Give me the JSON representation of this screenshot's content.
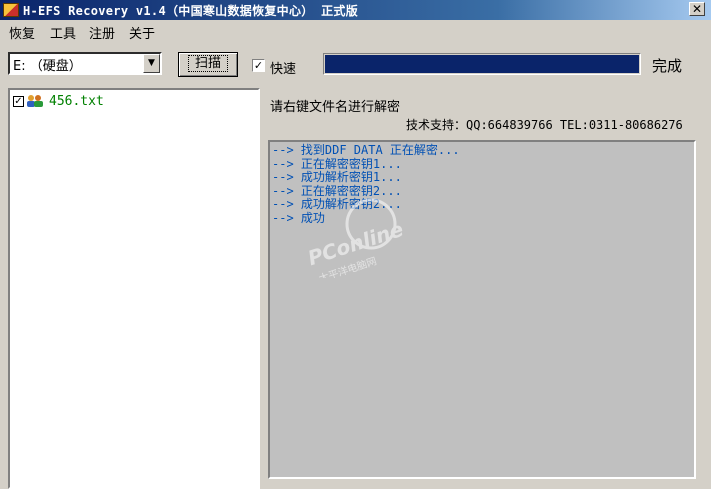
{
  "window": {
    "title": "H-EFS Recovery v1.4（中国寒山数据恢复中心） 正式版",
    "close_glyph": "✕"
  },
  "menu": {
    "items": [
      "恢复",
      "工具",
      "注册",
      "关于"
    ]
  },
  "toolbar": {
    "drive_value": "E: （硬盘）",
    "drop_glyph": "▼",
    "scan_label": "扫描",
    "fast_label": "快速",
    "fast_checked_glyph": "✓",
    "progress_fraction": 1.0,
    "status": "完成"
  },
  "file_tree": {
    "items": [
      {
        "label": "456.txt",
        "checked_glyph": "✓"
      }
    ]
  },
  "info": {
    "instruction": "请右键文件名进行解密",
    "support": "技术支持：QQ:664839766 TEL:0311-80686276"
  },
  "log": {
    "lines": [
      "--> 找到DDF DATA 正在解密...",
      "--> 正在解密密钥1...",
      "--> 成功解析密钥1...",
      "--> 正在解密密钥2...",
      "--> 成功解析密钥2...",
      "--> 成功"
    ]
  },
  "watermark": {
    "brand": "PConline",
    "subtitle": "太平洋电脑网"
  },
  "colors": {
    "progress": "#0a246a",
    "log_text": "#0050b4",
    "tree_label": "#008000"
  }
}
